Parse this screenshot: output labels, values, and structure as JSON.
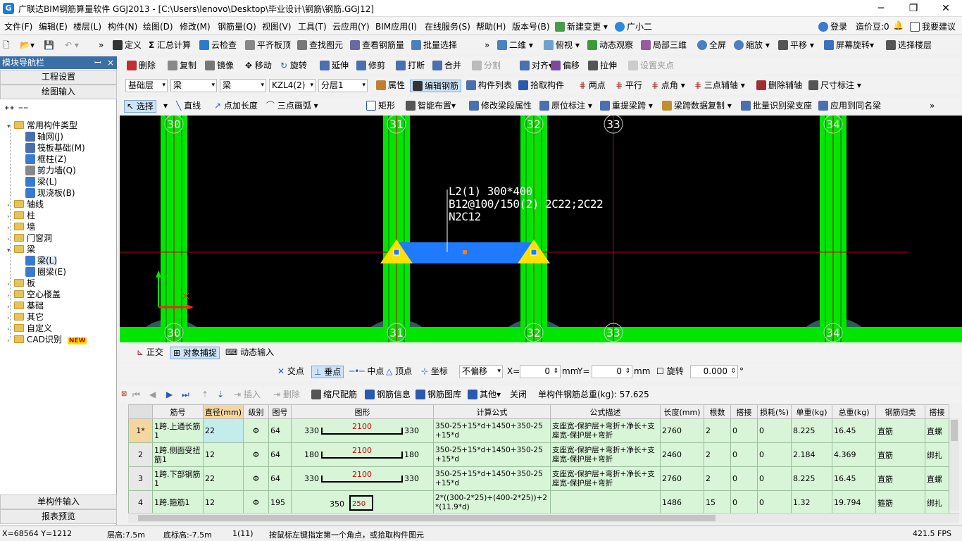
{
  "window": {
    "title": "广联达BIM钢筋算量软件 GGJ2013 - [C:\\Users\\lenovo\\Desktop\\毕业设计\\钢筋\\钢筋.GGJ12]",
    "min": "─",
    "restore": "❐",
    "close": "✕"
  },
  "menu": {
    "items": [
      "文件(F)",
      "编辑(E)",
      "楼层(L)",
      "构件(N)",
      "绘图(D)",
      "修改(M)",
      "钢筋量(Q)",
      "视图(V)",
      "工具(T)",
      "云应用(Y)",
      "BIM应用(I)",
      "在线服务(S)",
      "帮助(H)",
      "版本号(B)",
      "新建变更",
      "广小二"
    ],
    "right": {
      "login": "登录",
      "price": "造价豆:0",
      "suggest": "我要建议"
    }
  },
  "toolbar1": {
    "define": "定义",
    "sum": "汇总计算",
    "cloudcheck": "云检查",
    "flatslab": "平齐板顶",
    "findelem": "查找图元",
    "viewrebar": "查看钢筋量",
    "batchselect": "批量选择",
    "view2d": "二维",
    "topview": "俯视",
    "dynamic": "动态观察",
    "local3d": "局部三维",
    "fullscreen": "全屏",
    "zoom": "缩放",
    "pan": "平移",
    "rotate": "屏幕旋转",
    "selectfloor": "选择楼层"
  },
  "toolbar2": {
    "delete": "删除",
    "copy": "复制",
    "mirror": "镜像",
    "move": "移动",
    "rotate": "旋转",
    "extend": "延伸",
    "trim": "修剪",
    "break": "打断",
    "merge": "合并",
    "split": "分割",
    "align": "对齐",
    "offset": "偏移",
    "stretch": "拉伸",
    "setpoint": "设置夹点"
  },
  "toolbar3": {
    "floor": "基础层",
    "type": "梁",
    "subtype": "梁",
    "elem": "KZL4(2)",
    "layer": "分层1",
    "props": "属性",
    "editrebar": "编辑钢筋",
    "elemlist": "构件列表",
    "pick": "拾取构件",
    "twopoint": "两点",
    "parallel": "平行",
    "pointangle": "点角",
    "threepoint": "三点辅轴",
    "delaux": "删除辅轴",
    "dim": "尺寸标注"
  },
  "toolbar4": {
    "select": "选择",
    "line": "直线",
    "addlen": "点加长度",
    "arc": "三点画弧",
    "rect": "矩形",
    "smart": "智能布置",
    "modseg": "修改梁段属性",
    "inplace": "原位标注",
    "relift": "重提梁跨",
    "copyspan": "梁跨数据复制",
    "batchid": "批量识别梁支座",
    "applysame": "应用到同名梁"
  },
  "nav": {
    "header": "模块导航栏",
    "pin": "ꟷ",
    "close": "×",
    "engsetting": "工程设置",
    "drawinput": "绘图输入",
    "singleinput": "单构件输入",
    "report": "报表预览",
    "tree": [
      {
        "label": "常用构件类型",
        "level": 0,
        "expand": "▾"
      },
      {
        "label": "轴网(J)",
        "level": 1
      },
      {
        "label": "筏板基础(M)",
        "level": 1
      },
      {
        "label": "框柱(Z)",
        "level": 1
      },
      {
        "label": "剪力墙(Q)",
        "level": 1
      },
      {
        "label": "梁(L)",
        "level": 1
      },
      {
        "label": "现浇板(B)",
        "level": 1
      },
      {
        "label": "轴线",
        "level": 0,
        "expand": "›"
      },
      {
        "label": "柱",
        "level": 0,
        "expand": "›"
      },
      {
        "label": "墙",
        "level": 0,
        "expand": "›"
      },
      {
        "label": "门窗洞",
        "level": 0,
        "expand": "›"
      },
      {
        "label": "梁",
        "level": 0,
        "expand": "▾"
      },
      {
        "label": "梁(L)",
        "level": 1
      },
      {
        "label": "圈梁(E)",
        "level": 1
      },
      {
        "label": "板",
        "level": 0,
        "expand": "›"
      },
      {
        "label": "空心楼盖",
        "level": 0,
        "expand": "›"
      },
      {
        "label": "基础",
        "level": 0,
        "expand": "›"
      },
      {
        "label": "其它",
        "level": 0,
        "expand": "›"
      },
      {
        "label": "自定义",
        "level": 0,
        "expand": "›"
      },
      {
        "label": "CAD识别",
        "level": 0,
        "expand": "›",
        "badge": "NEW"
      }
    ]
  },
  "canvas": {
    "axes": [
      "30",
      "31",
      "32",
      "33",
      "34"
    ],
    "beam_label": [
      "L2(1) 300*400",
      "B12@100/150(2) 2C22;2C22",
      "N2C12"
    ]
  },
  "snapbar": {
    "ortho": "正交",
    "snap": "对象捕捉",
    "dyninput": "动态输入",
    "intersect": "交点",
    "perp": "垂点",
    "mid": "中点",
    "vertex": "顶点",
    "coord": "坐标",
    "offsetmode": "不偏移",
    "xlabel": "X=",
    "xval": "0",
    "ylabel": "Y=",
    "yval": "0",
    "unit": "mm",
    "rotate": "旋转",
    "rotval": "0.000",
    "deg": "°"
  },
  "rebarbar": {
    "insert": "插入",
    "delete": "删除",
    "scale": "缩尺配筋",
    "info": "钢筋信息",
    "lib": "钢筋图库",
    "other": "其他",
    "close": "关闭",
    "total": "单构件钢筋总重(kg): 57.625"
  },
  "grid": {
    "headers": [
      "筋号",
      "直径(mm)",
      "级别",
      "图号",
      "图形",
      "计算公式",
      "公式描述",
      "长度(mm)",
      "根数",
      "搭接",
      "损耗(%)",
      "单重(kg)",
      "总重(kg)",
      "钢筋归类",
      "搭接"
    ],
    "rows": [
      {
        "idx": "1*",
        "name": "1跨.上通长筋1",
        "dia": "22",
        "grade": "Φ",
        "fig": "64",
        "l": "330",
        "mid": "2100",
        "r": "330",
        "formula": "350-25+15*d+1450+350-25+15*d",
        "desc": "支座宽-保护层+弯折+净长+支座宽-保护层+弯折",
        "len": "2760",
        "count": "2",
        "lap": "0",
        "loss": "0",
        "unit": "8.225",
        "total": "16.45",
        "cat": "直筋",
        "lapt": "直螺"
      },
      {
        "idx": "2",
        "name": "1跨.侧面受扭筋1",
        "dia": "12",
        "grade": "Φ",
        "fig": "64",
        "l": "180",
        "mid": "2100",
        "r": "180",
        "formula": "350-25+15*d+1450+350-25+15*d",
        "desc": "支座宽-保护层+弯折+净长+支座宽-保护层+弯折",
        "len": "2460",
        "count": "2",
        "lap": "0",
        "loss": "0",
        "unit": "2.184",
        "total": "4.369",
        "cat": "直筋",
        "lapt": "绑扎"
      },
      {
        "idx": "3",
        "name": "1跨.下部钢筋1",
        "dia": "22",
        "grade": "Φ",
        "fig": "64",
        "l": "330",
        "mid": "2100",
        "r": "330",
        "formula": "350-25+15*d+1450+350-25+15*d",
        "desc": "支座宽-保护层+弯折+净长+支座宽-保护层+弯折",
        "len": "2760",
        "count": "2",
        "lap": "0",
        "loss": "0",
        "unit": "8.225",
        "total": "16.45",
        "cat": "直筋",
        "lapt": "直螺"
      },
      {
        "idx": "4",
        "name": "1跨.箍筋1",
        "dia": "12",
        "grade": "Φ",
        "fig": "195",
        "l": "350",
        "mid": "250",
        "r": "",
        "formula": "2*((300-2*25)+(400-2*25))+2*(11.9*d)",
        "desc": "",
        "len": "1486",
        "count": "15",
        "lap": "0",
        "loss": "0",
        "unit": "1.32",
        "total": "19.794",
        "cat": "箍筋",
        "lapt": "绑扎"
      }
    ]
  },
  "status": {
    "coords": "X=68564 Y=1212",
    "floorh": "层高:7.5m",
    "bottom": "底标高:-7.5m",
    "sel": "1(11)",
    "hint": "按鼠标左键指定第一个角点，或拾取构件图元",
    "fps": "421.5 FPS"
  },
  "colors": {
    "column": "#00e600",
    "beam": "#1e7bff",
    "axisline": "#c00000",
    "support": "#ffe000"
  }
}
